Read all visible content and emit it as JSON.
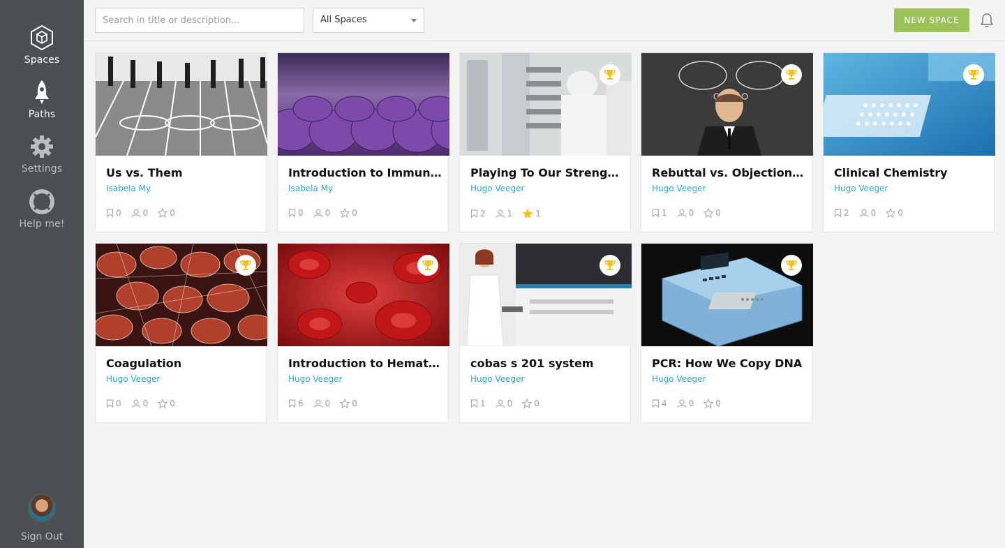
{
  "sidebar": {
    "items": [
      {
        "label": "Spaces",
        "icon": "hexagon-cube-icon"
      },
      {
        "label": "Paths",
        "icon": "rocket-icon"
      },
      {
        "label": "Settings",
        "icon": "gear-icon"
      },
      {
        "label": "Help me!",
        "icon": "lifebuoy-icon"
      }
    ],
    "signout": "Sign Out"
  },
  "topbar": {
    "search_placeholder": "Search in title or description...",
    "filter_value": "All Spaces",
    "new_space_label": "NEW SPACE"
  },
  "colors": {
    "sidebar_bg": "#4a4f51",
    "accent_green": "#9cc35a",
    "author_link": "#2aa7c6",
    "star_gold": "#f2c221"
  },
  "cards": [
    {
      "title": "Us vs. Them",
      "author": "Isabela My",
      "bookmarks": "0",
      "users": "0",
      "stars": "0",
      "starred": false,
      "trophy": false
    },
    {
      "title": "Introduction to Immunology",
      "author": "Isabela My",
      "bookmarks": "0",
      "users": "0",
      "stars": "0",
      "starred": false,
      "trophy": false
    },
    {
      "title": "Playing To Our Strengths",
      "author": "Hugo Veeger",
      "bookmarks": "2",
      "users": "1",
      "stars": "1",
      "starred": true,
      "trophy": true
    },
    {
      "title": "Rebuttal vs. Objection Handling",
      "author": "Hugo Veeger",
      "bookmarks": "1",
      "users": "0",
      "stars": "0",
      "starred": false,
      "trophy": true
    },
    {
      "title": "Clinical Chemistry",
      "author": "Hugo Veeger",
      "bookmarks": "2",
      "users": "0",
      "stars": "0",
      "starred": false,
      "trophy": true
    },
    {
      "title": "Coagulation",
      "author": "Hugo Veeger",
      "bookmarks": "0",
      "users": "0",
      "stars": "0",
      "starred": false,
      "trophy": true
    },
    {
      "title": "Introduction to Hematology",
      "author": "Hugo Veeger",
      "bookmarks": "6",
      "users": "0",
      "stars": "0",
      "starred": false,
      "trophy": true
    },
    {
      "title": "cobas s 201 system",
      "author": "Hugo Veeger",
      "bookmarks": "1",
      "users": "0",
      "stars": "0",
      "starred": false,
      "trophy": true
    },
    {
      "title": "PCR: How We Copy DNA",
      "author": "Hugo Veeger",
      "bookmarks": "4",
      "users": "0",
      "stars": "0",
      "starred": false,
      "trophy": true
    }
  ]
}
